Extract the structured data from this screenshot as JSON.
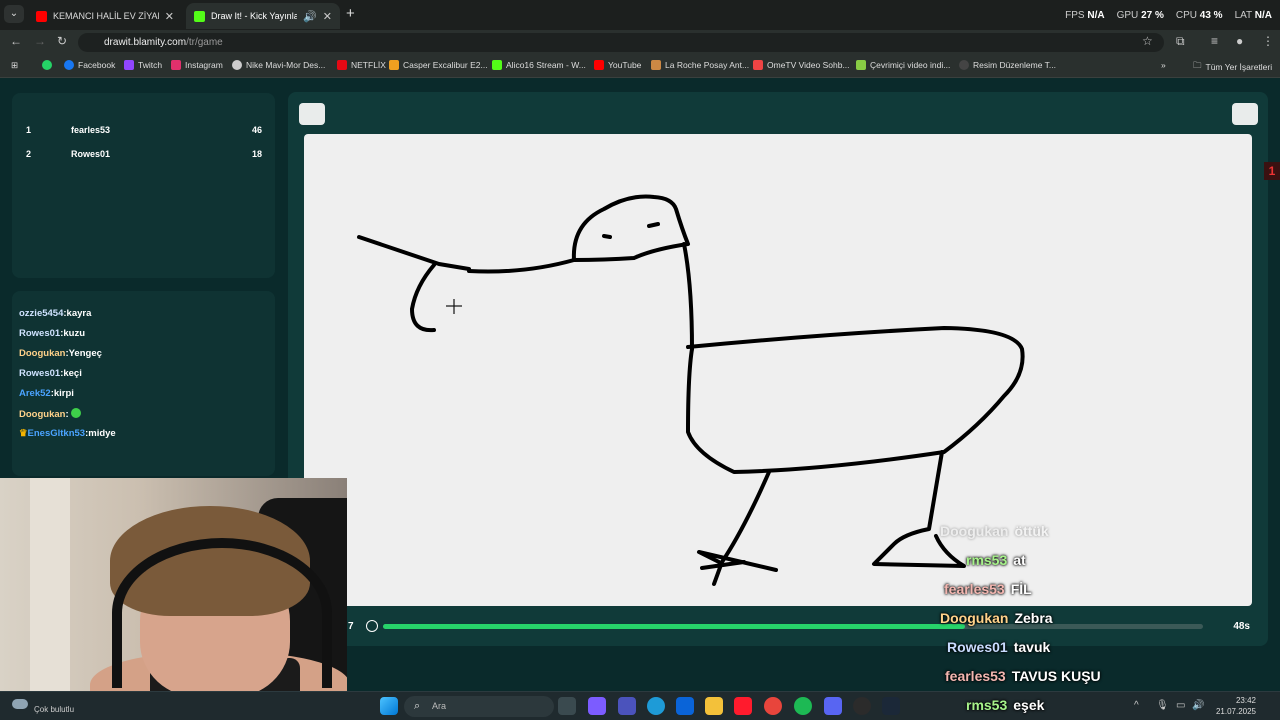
{
  "browser": {
    "tabs": [
      {
        "title": "KEMANCI HALİL EV ZİYARETİ V",
        "favicon_color": "#ff0000",
        "active": false
      },
      {
        "title": "Draw It! - Kick Yayınları İçin",
        "favicon_color": "#53fc18",
        "active": true
      }
    ],
    "new_tab": "+",
    "stats": {
      "fps_label": "FPS",
      "fps": "N/A",
      "gpu_label": "GPU",
      "gpu": "27 %",
      "cpu_label": "CPU",
      "cpu": "43 %",
      "lat_label": "LAT",
      "lat": "N/A"
    },
    "url_host": "drawit.blamity.com",
    "url_path": "/tr/game",
    "bookmarks": [
      {
        "label": "Facebook",
        "color": "#1877f2"
      },
      {
        "label": "Twitch",
        "color": "#9146ff"
      },
      {
        "label": "Instagram",
        "color": "#e1306c"
      },
      {
        "label": "Nike Mavi-Mor Des...",
        "color": "#cccccc"
      },
      {
        "label": "NETFLİX",
        "color": "#e50914"
      },
      {
        "label": "Casper Excalibur E2...",
        "color": "#f0a020"
      },
      {
        "label": "Alico16 Stream - W...",
        "color": "#53fc18"
      },
      {
        "label": "YouTube",
        "color": "#ff0000"
      },
      {
        "label": "La Roche Posay Ant...",
        "color": "#cc8844"
      },
      {
        "label": "OmeTV Video Sohb...",
        "color": "#e44"
      },
      {
        "label": "Çevrimiçi video indi...",
        "color": "#8c4"
      },
      {
        "label": "Resim Düzenleme T...",
        "color": "#444"
      }
    ],
    "all_bookmarks": "Tüm Yer İşaretleri"
  },
  "scoreboard": [
    {
      "rank": "1",
      "name": "fearles53",
      "points": "46"
    },
    {
      "rank": "2",
      "name": "Rowes01",
      "points": "18"
    }
  ],
  "chat": [
    {
      "user": "ozzie5454",
      "msg": ":kayra",
      "color": "#cfe3ff"
    },
    {
      "user": "Rowes01",
      "msg": ":kuzu",
      "color": "#cfe3ff"
    },
    {
      "user": "Doogukan",
      "msg": ":Yengeç",
      "color": "#ffd28a"
    },
    {
      "user": "Rowes01",
      "msg": ":keçi",
      "color": "#cfe3ff"
    },
    {
      "user": "Arek52",
      "msg": ":kirpi",
      "color": "#4aa3ff"
    },
    {
      "user": "Doogukan",
      "msg": ":",
      "color": "#ffd28a"
    },
    {
      "user": "EnesGltkn53",
      "msg": ":midye",
      "color": "#4aa3ff"
    }
  ],
  "timer": {
    "round": "7",
    "seconds": "48s",
    "progress": 0.71
  },
  "edge_badge": "1",
  "stream_overlay": [
    {
      "user": "Doogukan",
      "msg": "öttük",
      "user_color": "#e8e8e8",
      "faded": true
    },
    {
      "user": "rms53",
      "msg": "at",
      "user_color": "#a6f28a",
      "faded": false
    },
    {
      "user": "fearles53",
      "msg": "FİL",
      "user_color": "#f3b6b0",
      "faded": false
    },
    {
      "user": "Doogukan",
      "msg": "Zebra",
      "user_color": "#ffd28a",
      "faded": false
    },
    {
      "user": "Rowes01",
      "msg": "tavuk",
      "user_color": "#c9dcff",
      "faded": false
    },
    {
      "user": "fearles53",
      "msg": "TAVUS KUŞU",
      "user_color": "#f3b6b0",
      "faded": false
    },
    {
      "user": "rms53",
      "msg": "eşek",
      "user_color": "#a6f28a",
      "faded": false
    }
  ],
  "taskbar": {
    "weather": "Çok bulutlu",
    "search_placeholder": "Ara",
    "time": "23:42",
    "date": "21.07.2025"
  }
}
